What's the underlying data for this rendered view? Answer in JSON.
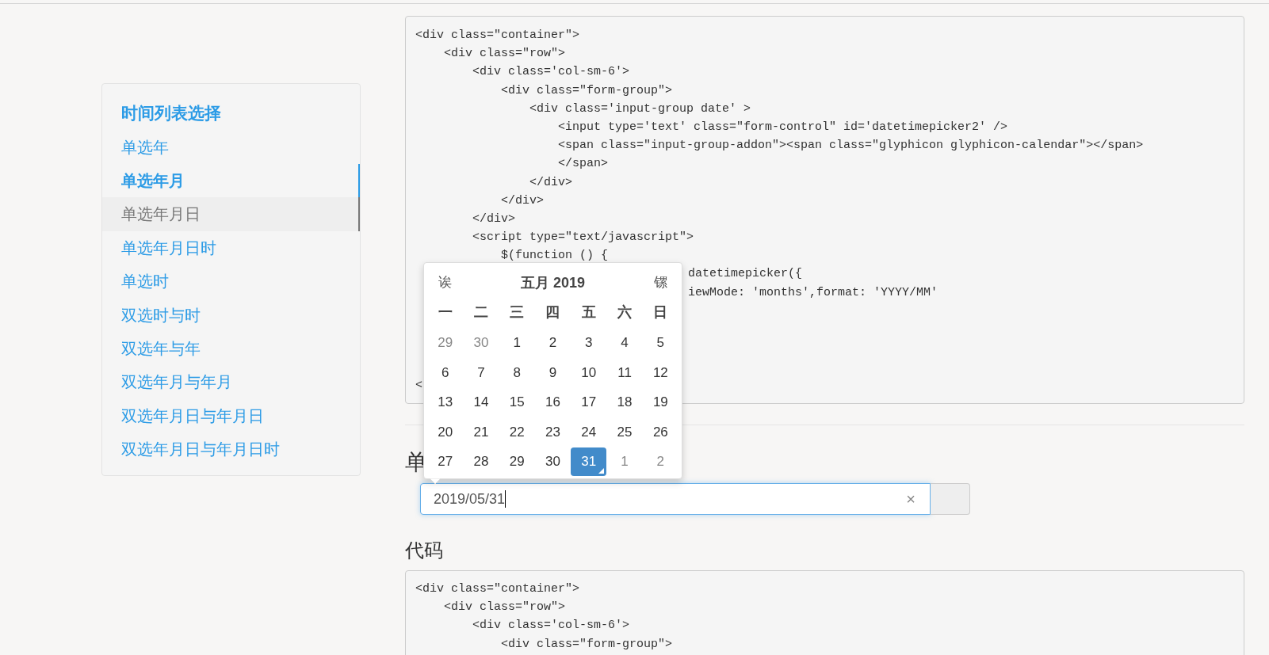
{
  "sidebar": {
    "title": "时间列表选择",
    "items": [
      {
        "label": "单选年",
        "selected": false,
        "hovered": false
      },
      {
        "label": "单选年月",
        "selected": true,
        "hovered": false
      },
      {
        "label": "单选年月日",
        "selected": false,
        "hovered": true
      },
      {
        "label": "单选年月日时",
        "selected": false,
        "hovered": false
      },
      {
        "label": "单选时",
        "selected": false,
        "hovered": false
      },
      {
        "label": "双选时与时",
        "selected": false,
        "hovered": false
      },
      {
        "label": "双选年与年",
        "selected": false,
        "hovered": false
      },
      {
        "label": "双选年月与年月",
        "selected": false,
        "hovered": false
      },
      {
        "label": "双选年月日与年月日",
        "selected": false,
        "hovered": false
      },
      {
        "label": "双选年月日与年月日时",
        "selected": false,
        "hovered": false
      }
    ]
  },
  "code_block_1": {
    "lines": [
      {
        "kind": "full",
        "text": "<div class=\"container\">"
      },
      {
        "kind": "full",
        "text": "    <div class=\"row\">"
      },
      {
        "kind": "full",
        "text": "        <div class='col-sm-6'>"
      },
      {
        "kind": "full",
        "text": "            <div class=\"form-group\">"
      },
      {
        "kind": "full",
        "text": "                <div class='input-group date' >"
      },
      {
        "kind": "full",
        "text": "                    <input type='text' class=\"form-control\" id='datetimepicker2' />"
      },
      {
        "kind": "full",
        "text": "                    <span class=\"input-group-addon\"><span class=\"glyphicon glyphicon-calendar\"></span>"
      },
      {
        "kind": "full",
        "text": "                    </span>"
      },
      {
        "kind": "full",
        "text": "                </div>"
      },
      {
        "kind": "full",
        "text": "            </div>"
      },
      {
        "kind": "full",
        "text": "        </div>"
      },
      {
        "kind": "full",
        "text": "        <script type=\"text/javascript\">"
      },
      {
        "kind": "full",
        "text": "            $(function () {"
      },
      {
        "kind": "partial",
        "text": "datetimepicker({"
      },
      {
        "kind": "partial",
        "text": "iewMode: 'months',format: 'YYYY/MM'"
      }
    ],
    "trailing_line": "<"
  },
  "section_heading": "单",
  "date_field": {
    "value": "2019/05/31",
    "clear": "×"
  },
  "code_heading": "代码",
  "code_block_2": {
    "lines": [
      "<div class=\"container\">",
      "    <div class=\"row\">",
      "        <div class='col-sm-6'>",
      "            <div class=\"form-group\">"
    ]
  },
  "calendar": {
    "prev": "诶",
    "title": "五月 2019",
    "next": "镙",
    "weekdays": [
      "一",
      "二",
      "三",
      "四",
      "五",
      "六",
      "日"
    ],
    "days": [
      {
        "label": "29",
        "kind": "old",
        "selected": false
      },
      {
        "label": "30",
        "kind": "old",
        "selected": false
      },
      {
        "label": "1",
        "kind": "day",
        "selected": false
      },
      {
        "label": "2",
        "kind": "day",
        "selected": false
      },
      {
        "label": "3",
        "kind": "day",
        "selected": false
      },
      {
        "label": "4",
        "kind": "day",
        "selected": false
      },
      {
        "label": "5",
        "kind": "day",
        "selected": false
      },
      {
        "label": "6",
        "kind": "day",
        "selected": false
      },
      {
        "label": "7",
        "kind": "day",
        "selected": false
      },
      {
        "label": "8",
        "kind": "day",
        "selected": false
      },
      {
        "label": "9",
        "kind": "day",
        "selected": false
      },
      {
        "label": "10",
        "kind": "day",
        "selected": false
      },
      {
        "label": "11",
        "kind": "day",
        "selected": false
      },
      {
        "label": "12",
        "kind": "day",
        "selected": false
      },
      {
        "label": "13",
        "kind": "day",
        "selected": false
      },
      {
        "label": "14",
        "kind": "day",
        "selected": false
      },
      {
        "label": "15",
        "kind": "day",
        "selected": false
      },
      {
        "label": "16",
        "kind": "day",
        "selected": false
      },
      {
        "label": "17",
        "kind": "day",
        "selected": false
      },
      {
        "label": "18",
        "kind": "day",
        "selected": false
      },
      {
        "label": "19",
        "kind": "day",
        "selected": false
      },
      {
        "label": "20",
        "kind": "day",
        "selected": false
      },
      {
        "label": "21",
        "kind": "day",
        "selected": false
      },
      {
        "label": "22",
        "kind": "day",
        "selected": false
      },
      {
        "label": "23",
        "kind": "day",
        "selected": false
      },
      {
        "label": "24",
        "kind": "day",
        "selected": false
      },
      {
        "label": "25",
        "kind": "day",
        "selected": false
      },
      {
        "label": "26",
        "kind": "day",
        "selected": false
      },
      {
        "label": "27",
        "kind": "day",
        "selected": false
      },
      {
        "label": "28",
        "kind": "day",
        "selected": false
      },
      {
        "label": "29",
        "kind": "day",
        "selected": false
      },
      {
        "label": "30",
        "kind": "day",
        "selected": false
      },
      {
        "label": "31",
        "kind": "day",
        "selected": true
      },
      {
        "label": "1",
        "kind": "new",
        "selected": false
      },
      {
        "label": "2",
        "kind": "new",
        "selected": false
      }
    ]
  }
}
